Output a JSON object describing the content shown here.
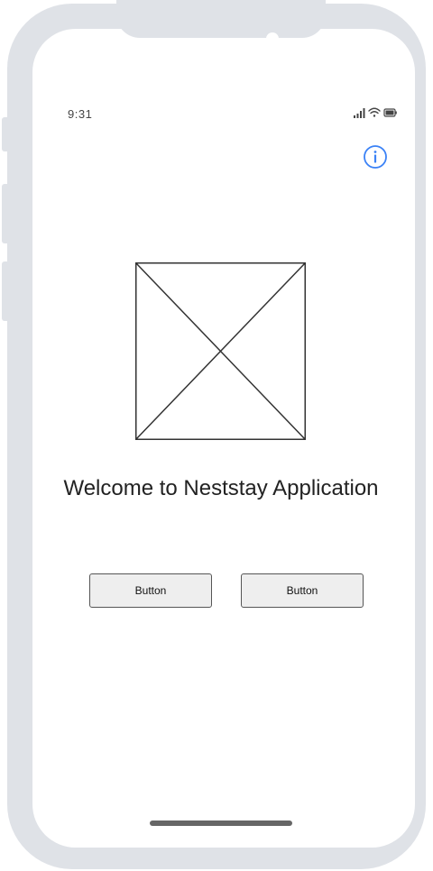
{
  "status_bar": {
    "time": "9:31",
    "icons": [
      "signal-icon",
      "wifi-icon",
      "battery-icon"
    ]
  },
  "header": {
    "info_icon": "info-icon"
  },
  "main": {
    "image_placeholder": "image-placeholder-icon",
    "welcome_text": "Welcome to Neststay Application",
    "buttons": [
      {
        "label": "Button"
      },
      {
        "label": "Button"
      }
    ]
  },
  "colors": {
    "frame": "#dfe2e7",
    "accent": "#3b82f6",
    "button_bg": "#eeeeee",
    "home_indicator": "#666666"
  }
}
